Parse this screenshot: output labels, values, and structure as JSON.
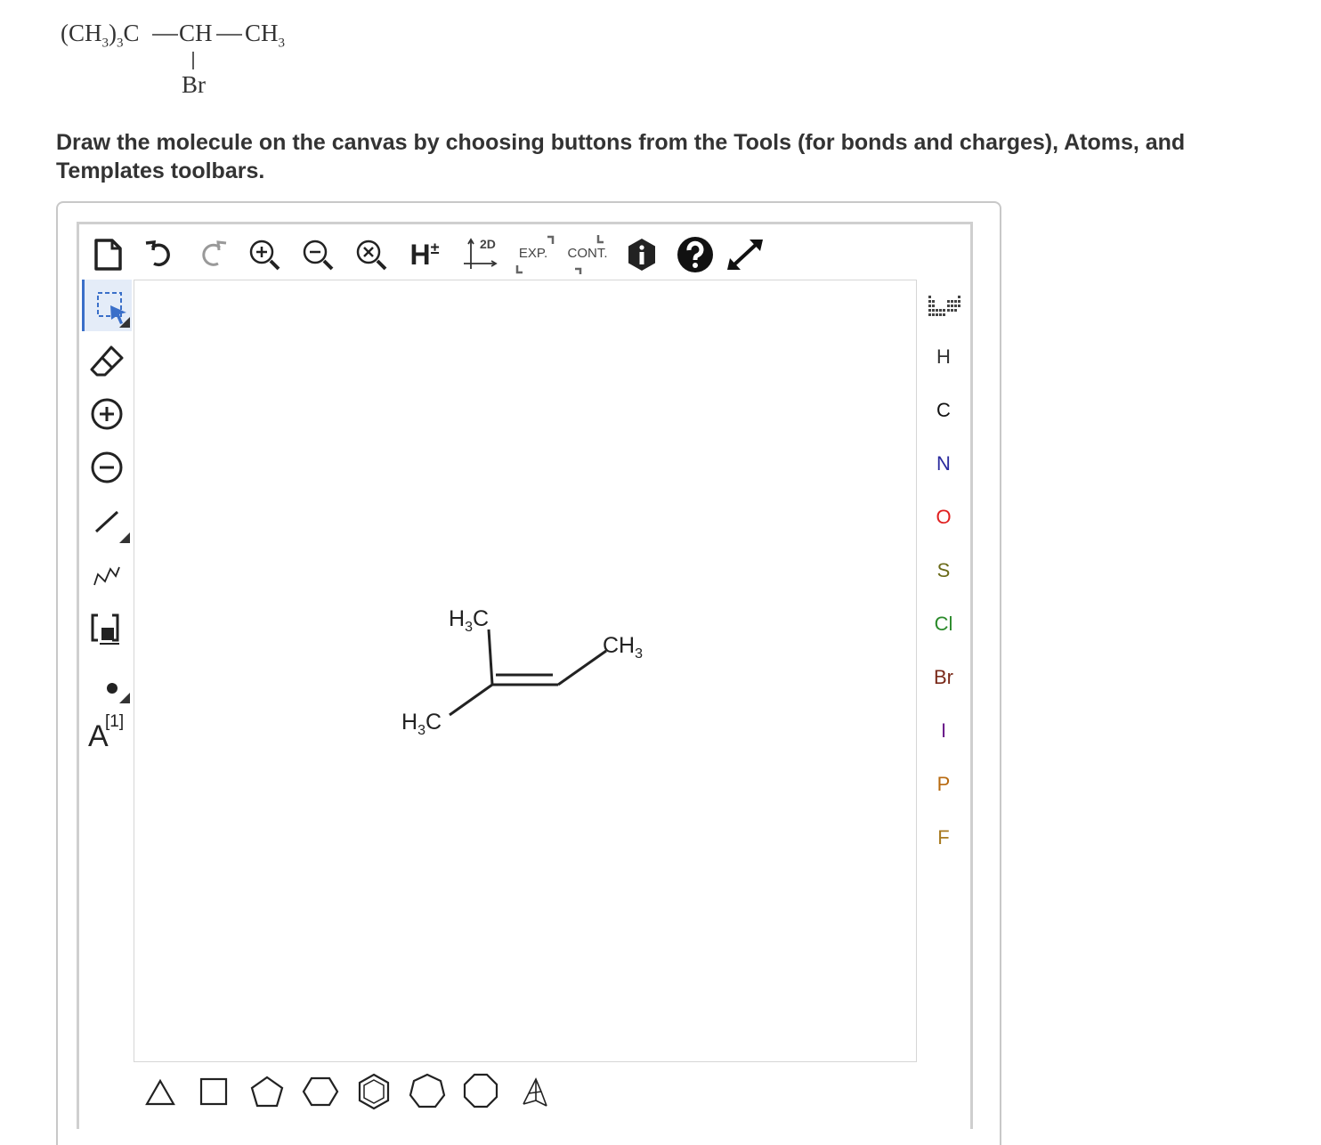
{
  "question": {
    "formula": {
      "group1": "(CH",
      "sub1": "3",
      "group1_close": ")",
      "sub2": "3",
      "c": "C",
      "ch": "CH",
      "ch3": "CH",
      "sub3": "3",
      "br": "Br"
    },
    "instruction": "Draw the molecule on the canvas by choosing buttons from the Tools (for bonds and charges), Atoms, and Templates toolbars."
  },
  "top_toolbar": {
    "h_label": "H",
    "h_sign": "±",
    "clean_label": "2D",
    "expand_label": "EXP.",
    "contract_label": "CONT."
  },
  "left_toolbar": {
    "atom_map_label": "[1]",
    "atom_map_letter": "A"
  },
  "atoms": [
    {
      "symbol": "H",
      "color": "#333333"
    },
    {
      "symbol": "C",
      "color": "#111111"
    },
    {
      "symbol": "N",
      "color": "#2b2b9e"
    },
    {
      "symbol": "O",
      "color": "#e02020"
    },
    {
      "symbol": "S",
      "color": "#6b6b1a"
    },
    {
      "symbol": "Cl",
      "color": "#2a8a2a"
    },
    {
      "symbol": "Br",
      "color": "#7a2a1a"
    },
    {
      "symbol": "I",
      "color": "#6a1a8a"
    },
    {
      "symbol": "P",
      "color": "#b86a10"
    },
    {
      "symbol": "F",
      "color": "#a87a20"
    }
  ],
  "molecule": {
    "label_top": {
      "h": "H",
      "sub": "3",
      "c": "C"
    },
    "label_left": {
      "h": "H",
      "sub": "3",
      "c": "C"
    },
    "label_right": {
      "c": "CH",
      "sub": "3"
    }
  }
}
